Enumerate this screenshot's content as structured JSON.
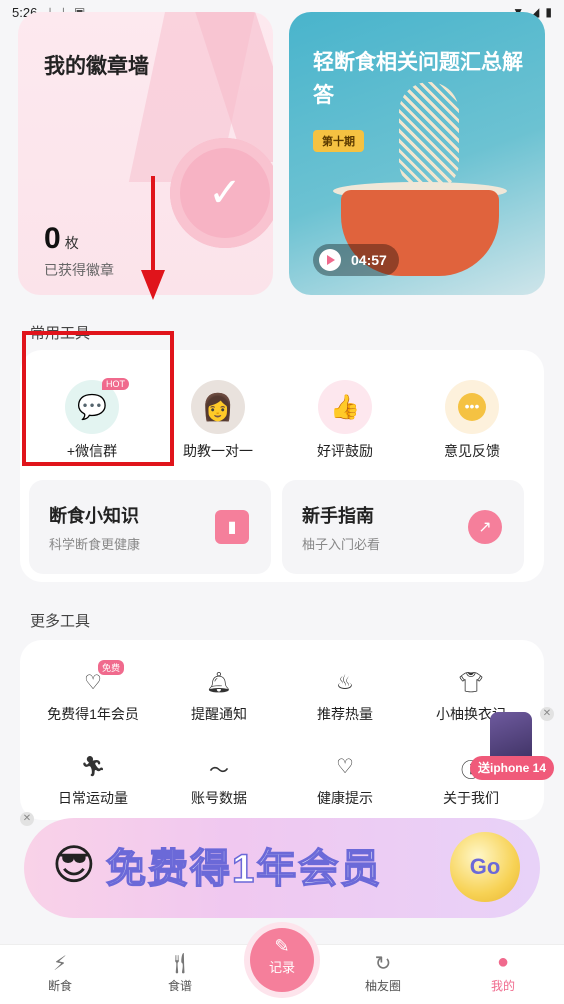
{
  "status_bar": {
    "time": "5:26",
    "icons": [
      "download-icon",
      "download-icon",
      "app-icon"
    ],
    "right_icons": [
      "wifi-icon",
      "signal-icon",
      "battery-icon"
    ]
  },
  "badge_wall": {
    "title": "我的徽章墙",
    "count": "0",
    "unit": "枚",
    "subtitle": "已获得徽章"
  },
  "video_card": {
    "title": "轻断食相关问题汇总解答",
    "tag": "第十期",
    "duration": "04:57"
  },
  "common_tools": {
    "label": "常用工具",
    "items": [
      {
        "label": "+微信群",
        "icon": "wechat-group-icon",
        "hot": "HOT"
      },
      {
        "label": "助教一对一",
        "icon": "assistant-avatar"
      },
      {
        "label": "好评鼓励",
        "icon": "thumbs-up-icon"
      },
      {
        "label": "意见反馈",
        "icon": "feedback-icon"
      }
    ],
    "cards": [
      {
        "title": "断食小知识",
        "subtitle": "科学断食更健康",
        "icon": "book-icon"
      },
      {
        "title": "新手指南",
        "subtitle": "柚子入门必看",
        "icon": "trend-icon"
      }
    ]
  },
  "more_tools": {
    "label": "更多工具",
    "items": [
      {
        "label": "免费得1年会员",
        "icon": "heart-icon",
        "tag": "免费"
      },
      {
        "label": "提醒通知",
        "icon": "bell-icon"
      },
      {
        "label": "推荐热量",
        "icon": "flame-icon"
      },
      {
        "label": "小柚换衣记",
        "icon": "shirt-icon"
      },
      {
        "label": "日常运动量",
        "icon": "running-icon"
      },
      {
        "label": "账号数据",
        "icon": "chart-icon"
      },
      {
        "label": "健康提示",
        "icon": "heartbeat-icon"
      },
      {
        "label": "关于我们",
        "icon": "info-icon"
      }
    ]
  },
  "promo_banner": {
    "text": "免费得1年会员",
    "go": "Go"
  },
  "iphone_float": {
    "text": "送iphone 14"
  },
  "tabbar": {
    "items": [
      {
        "label": "断食",
        "icon": "lightning-icon"
      },
      {
        "label": "食谱",
        "icon": "cutlery-icon"
      },
      {
        "label": "记录",
        "icon": "pencil-icon"
      },
      {
        "label": "柚友圈",
        "icon": "circle-icon"
      },
      {
        "label": "我的",
        "icon": "user-icon"
      }
    ]
  },
  "colors": {
    "accent": "#f06a8d",
    "annotation": "#e0141b",
    "tag": "#f5c242"
  }
}
